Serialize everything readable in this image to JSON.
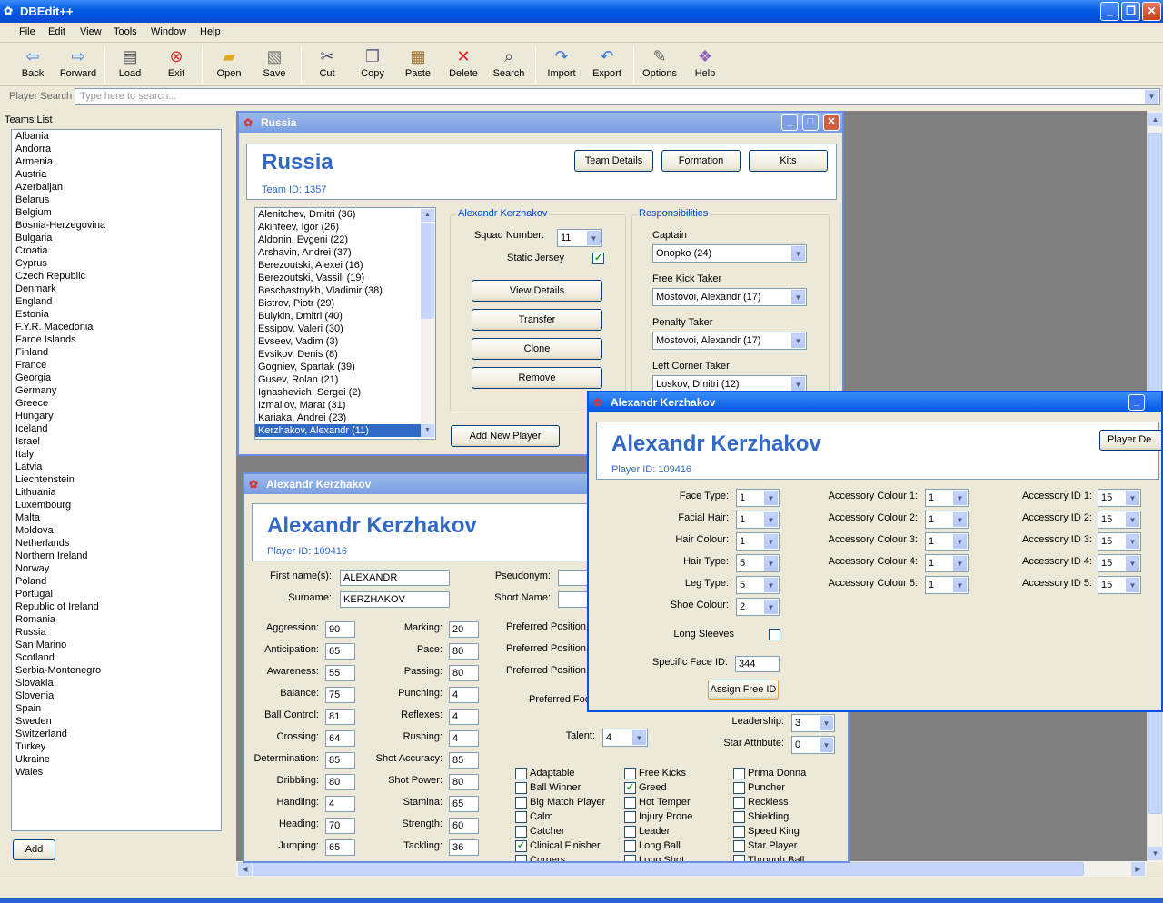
{
  "app": {
    "title": "DBEdit++"
  },
  "menu": [
    "File",
    "Edit",
    "View",
    "Tools",
    "Window",
    "Help"
  ],
  "toolbar": [
    "Back",
    "Forward",
    "Load",
    "Exit",
    "Open",
    "Save",
    "Cut",
    "Copy",
    "Paste",
    "Delete",
    "Search",
    "Import",
    "Export",
    "Options",
    "Help"
  ],
  "search": {
    "label": "Player Search",
    "placeholder": "Type here to search..."
  },
  "teams": {
    "header": "Teams List",
    "add_label": "Add",
    "items": [
      "Albania",
      "Andorra",
      "Armenia",
      "Austria",
      "Azerbaijan",
      "Belarus",
      "Belgium",
      "Bosnia-Herzegovina",
      "Bulgaria",
      "Croatia",
      "Cyprus",
      "Czech Republic",
      "Denmark",
      "England",
      "Estonia",
      "F.Y.R. Macedonia",
      "Faroe Islands",
      "Finland",
      "France",
      "Georgia",
      "Germany",
      "Greece",
      "Hungary",
      "Iceland",
      "Israel",
      "Italy",
      "Latvia",
      "Liechtenstein",
      "Lithuania",
      "Luxembourg",
      "Malta",
      "Moldova",
      "Netherlands",
      "Northern Ireland",
      "Norway",
      "Poland",
      "Portugal",
      "Republic of Ireland",
      "Romania",
      "Russia",
      "San Marino",
      "Scotland",
      "Serbia-Montenegro",
      "Slovakia",
      "Slovenia",
      "Spain",
      "Sweden",
      "Switzerland",
      "Turkey",
      "Ukraine",
      "Wales"
    ]
  },
  "team_window": {
    "title": "Russia",
    "name": "Russia",
    "team_id": "Team ID: 1357",
    "buttons": [
      "Team Details",
      "Formation",
      "Kits"
    ],
    "players": [
      "Alenitchev, Dmitri (36)",
      "Akinfeev, Igor (26)",
      "Aldonin, Evgeni (22)",
      "Arshavin, Andrei (37)",
      "Berezoutski, Alexei (16)",
      "Berezoutski, Vassili (19)",
      "Beschastnykh, Vladimir (38)",
      "Bistrov, Piotr (29)",
      "Bulykin, Dmitri (40)",
      "Essipov, Valeri (30)",
      "Evseev, Vadim (3)",
      "Evsikov, Denis (8)",
      "Gogniev, Spartak (39)",
      "Gusev, Rolan (21)",
      "Ignashevich, Sergei (2)",
      "Izmailov, Marat (31)",
      "Kariaka, Andrei (23)",
      "Kerzhakov, Alexandr (11)"
    ],
    "selected_group": "Alexandr Kerzhakov",
    "squad_number_label": "Squad Number:",
    "squad_number": "11",
    "static_jersey_label": "Static Jersey",
    "actions": [
      "View Details",
      "Transfer",
      "Clone",
      "Remove"
    ],
    "add_player": "Add New Player",
    "responsibilities": {
      "title": "Responsibilities",
      "captain_label": "Captain",
      "captain": "Onopko (24)",
      "freekick_label": "Free Kick Taker",
      "freekick": "Mostovoi, Alexandr (17)",
      "penalty_label": "Penalty Taker",
      "penalty": "Mostovoi, Alexandr (17)",
      "leftcorner_label": "Left Corner Taker",
      "leftcorner": "Loskov, Dmitri (12)"
    }
  },
  "player_window": {
    "title": "Alexandr Kerzhakov",
    "name": "Alexandr Kerzhakov",
    "player_id": "Player ID: 109416",
    "first_name_label": "First name(s):",
    "first_name": "ALEXANDR",
    "surname_label": "Surname:",
    "surname": "KERZHAKOV",
    "pseudonym_label": "Pseudonym:",
    "short_name_label": "Short Name:",
    "attrs_left": [
      {
        "label": "Aggression:",
        "value": "90"
      },
      {
        "label": "Anticipation:",
        "value": "65"
      },
      {
        "label": "Awareness:",
        "value": "55"
      },
      {
        "label": "Balance:",
        "value": "75"
      },
      {
        "label": "Ball Control:",
        "value": "81"
      },
      {
        "label": "Crossing:",
        "value": "64"
      },
      {
        "label": "Determination:",
        "value": "85"
      },
      {
        "label": "Dribbling:",
        "value": "80"
      },
      {
        "label": "Handling:",
        "value": "4"
      },
      {
        "label": "Heading:",
        "value": "70"
      },
      {
        "label": "Jumping:",
        "value": "65"
      }
    ],
    "attrs_mid": [
      {
        "label": "Marking:",
        "value": "20"
      },
      {
        "label": "Pace:",
        "value": "80"
      },
      {
        "label": "Passing:",
        "value": "80"
      },
      {
        "label": "Punching:",
        "value": "4"
      },
      {
        "label": "Reflexes:",
        "value": "4"
      },
      {
        "label": "Rushing:",
        "value": "4"
      },
      {
        "label": "Shot Accuracy:",
        "value": "85"
      },
      {
        "label": "Shot Power:",
        "value": "80"
      },
      {
        "label": "Stamina:",
        "value": "65"
      },
      {
        "label": "Strength:",
        "value": "60"
      },
      {
        "label": "Tackling:",
        "value": "36"
      }
    ],
    "pref_pos_label": "Preferred Position",
    "pref_foot_label": "Preferred Foo",
    "talent_label": "Talent:",
    "talent": "4",
    "leadership_label": "Leadership:",
    "leadership": "3",
    "star_label": "Star Attribute:",
    "star": "0",
    "traits_col1": [
      {
        "label": "Adaptable",
        "checked": false
      },
      {
        "label": "Ball Winner",
        "checked": false
      },
      {
        "label": "Big Match Player",
        "checked": false
      },
      {
        "label": "Calm",
        "checked": false
      },
      {
        "label": "Catcher",
        "checked": false
      },
      {
        "label": "Clinical Finisher",
        "checked": true
      },
      {
        "label": "Corners",
        "checked": false
      }
    ],
    "traits_col2": [
      {
        "label": "Free Kicks",
        "checked": false
      },
      {
        "label": "Greed",
        "checked": true
      },
      {
        "label": "Hot Temper",
        "checked": false
      },
      {
        "label": "Injury Prone",
        "checked": false
      },
      {
        "label": "Leader",
        "checked": false
      },
      {
        "label": "Long Ball",
        "checked": false
      },
      {
        "label": "Long Shot",
        "checked": false
      }
    ],
    "traits_col3": [
      {
        "label": "Prima Donna",
        "checked": false
      },
      {
        "label": "Puncher",
        "checked": false
      },
      {
        "label": "Reckless",
        "checked": false
      },
      {
        "label": "Shielding",
        "checked": false
      },
      {
        "label": "Speed King",
        "checked": false
      },
      {
        "label": "Star Player",
        "checked": false
      },
      {
        "label": "Through Ball",
        "checked": false
      }
    ]
  },
  "appearance_window": {
    "title": "Alexandr Kerzhakov",
    "name": "Alexandr Kerzhakov",
    "player_id": "Player ID: 109416",
    "button": "Player De",
    "col1": [
      {
        "label": "Face Type:",
        "value": "1"
      },
      {
        "label": "Facial Hair:",
        "value": "1"
      },
      {
        "label": "Hair Colour:",
        "value": "1"
      },
      {
        "label": "Hair Type:",
        "value": "5"
      },
      {
        "label": "Leg Type:",
        "value": "5"
      },
      {
        "label": "Shoe Colour:",
        "value": "2"
      }
    ],
    "col2": [
      {
        "label": "Accessory Colour 1:",
        "value": "1"
      },
      {
        "label": "Accessory Colour 2:",
        "value": "1"
      },
      {
        "label": "Accessory Colour 3:",
        "value": "1"
      },
      {
        "label": "Accessory Colour 4:",
        "value": "1"
      },
      {
        "label": "Accessory Colour 5:",
        "value": "1"
      }
    ],
    "col3": [
      {
        "label": "Accessory ID 1:",
        "value": "15"
      },
      {
        "label": "Accessory ID 2:",
        "value": "15"
      },
      {
        "label": "Accessory ID 3:",
        "value": "15"
      },
      {
        "label": "Accessory ID 4:",
        "value": "15"
      },
      {
        "label": "Accessory ID 5:",
        "value": "15"
      }
    ],
    "long_sleeves_label": "Long Sleeves",
    "face_id_label": "Specific Face ID:",
    "face_id": "344",
    "assign_label": "Assign Free ID"
  }
}
